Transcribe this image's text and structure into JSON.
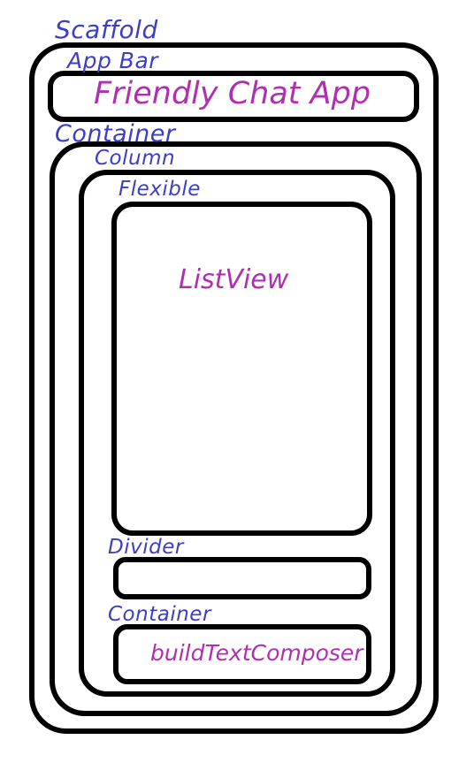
{
  "labels": {
    "scaffold": "Scaffold",
    "app_bar": "App Bar",
    "outer_container": "Container",
    "column": "Column",
    "flexible": "Flexible",
    "divider": "Divider",
    "inner_container": "Container"
  },
  "content": {
    "app_bar_title": "Friendly Chat App",
    "list_view": "ListView",
    "composer": "buildTextComposer"
  },
  "colors": {
    "widget_label": "#3b3fc4",
    "content_text": "#b02fb0",
    "outline": "#000000"
  }
}
